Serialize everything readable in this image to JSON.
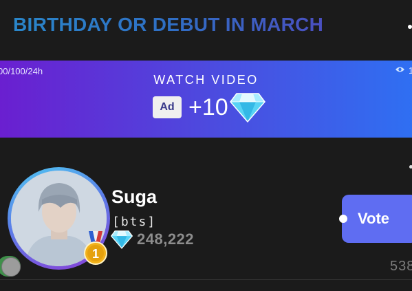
{
  "header": {
    "title": "BIRTHDAY OR DEBUT IN MARCH"
  },
  "banner": {
    "counter": "00/100/24h",
    "heading": "WATCH VIDEO",
    "ad_label": "Ad",
    "reward": "+10",
    "view_count": "1",
    "icons": [
      "eye-icon",
      "diamond-icon"
    ]
  },
  "candidate": {
    "name": "Suga",
    "group": "[bts]",
    "votes": "248,222",
    "rank": "1",
    "vote_button_label": "Vote",
    "side_stat": "538",
    "icons": [
      "diamond-icon",
      "medal-icon",
      "toggle"
    ]
  },
  "colors": {
    "background": "#1b1b1b",
    "banner_start": "#6a1fd0",
    "banner_end": "#2f6ff2",
    "vote_button": "#5f6df2",
    "medal_gold": "#f2b21b"
  }
}
